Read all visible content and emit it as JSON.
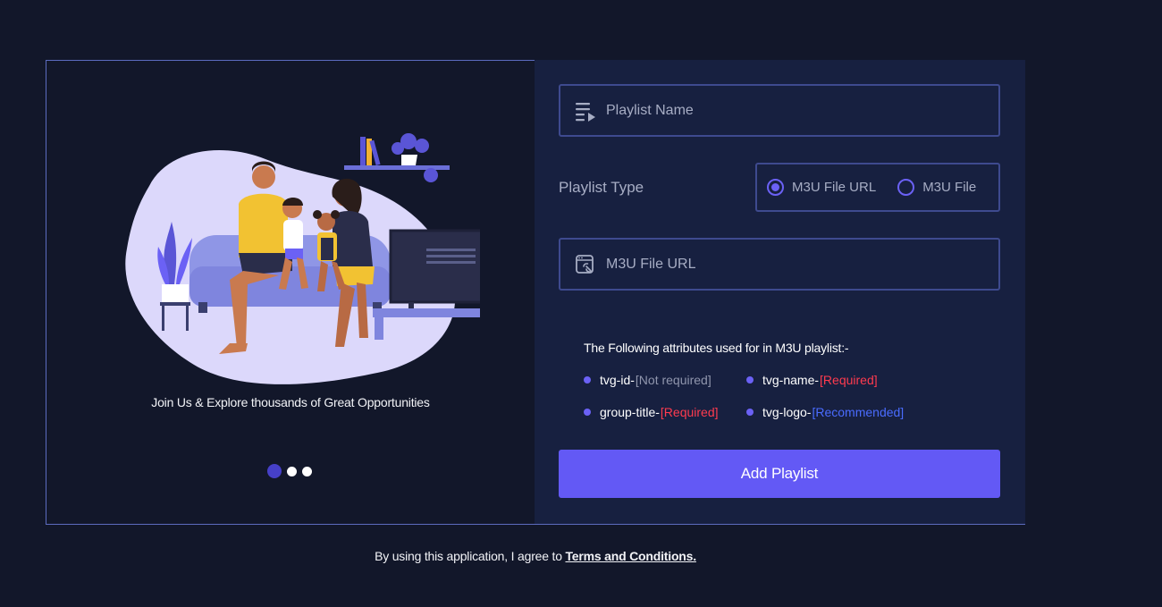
{
  "carousel": {
    "tagline": "Join Us & Explore thousands of Great Opportunities",
    "slide_count": 3,
    "active_slide": 1
  },
  "form": {
    "playlist_name": {
      "placeholder": "Playlist Name",
      "value": ""
    },
    "playlist_type": {
      "label": "Playlist Type",
      "options": [
        {
          "label": "M3U File URL",
          "selected": true
        },
        {
          "label": "M3U File",
          "selected": false
        }
      ]
    },
    "m3u_url": {
      "placeholder": "M3U File URL",
      "value": ""
    },
    "attributes": {
      "title": "The Following attributes used for in M3U playlist:-",
      "items": [
        {
          "name": "tvg-id-",
          "note": "[Not required]",
          "color": "#9096ad"
        },
        {
          "name": "tvg-name-",
          "note": "[Required]",
          "color": "#ff3b4f"
        },
        {
          "name": "group-title-",
          "note": "[Required]",
          "color": "#ff3b4f"
        },
        {
          "name": "tvg-logo-",
          "note": "[Recommended]",
          "color": "#4a6cff"
        }
      ]
    },
    "submit_label": "Add Playlist"
  },
  "footer": {
    "text": "By using this application, I agree to ",
    "link": "Terms and Conditions."
  },
  "colors": {
    "background": "#12172a",
    "panel": "#172040",
    "accent": "#6359f5",
    "field_border": "#3e4a8f"
  },
  "icons": {
    "playlist_name": "playlist-icon",
    "m3u_url": "link-file-icon"
  }
}
